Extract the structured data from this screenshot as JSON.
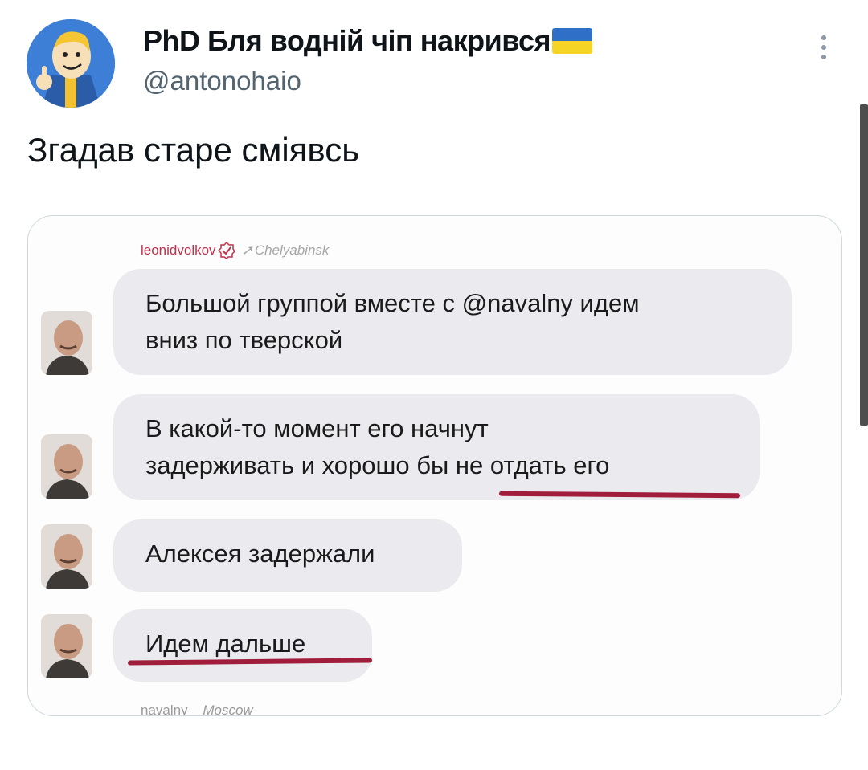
{
  "tweet": {
    "display_name": "PhD Бля водній чіп накрився",
    "handle": "@antonohaio",
    "text": "Згадав старе сміявсь",
    "flag_colors": {
      "top": "#2f6fc8",
      "bottom": "#f5d426"
    },
    "more_icon": "more-vertical-icon"
  },
  "screenshot": {
    "header_user": "leonidvolkov",
    "header_location": "Chelyabinsk",
    "messages": [
      {
        "lines": [
          "Большой группой вместе с @navalny идем",
          "вниз по тверской"
        ]
      },
      {
        "lines": [
          "В какой-то момент его начнут",
          "задерживать и хорошо бы не отдать его"
        ]
      },
      {
        "lines": [
          "Алексея задержали"
        ]
      },
      {
        "lines": [
          "Идем дальше"
        ]
      }
    ],
    "footer_user": "navalny",
    "footer_location": "Moscow",
    "underline_color": "#a01e3c",
    "accent": "#c0324b"
  }
}
